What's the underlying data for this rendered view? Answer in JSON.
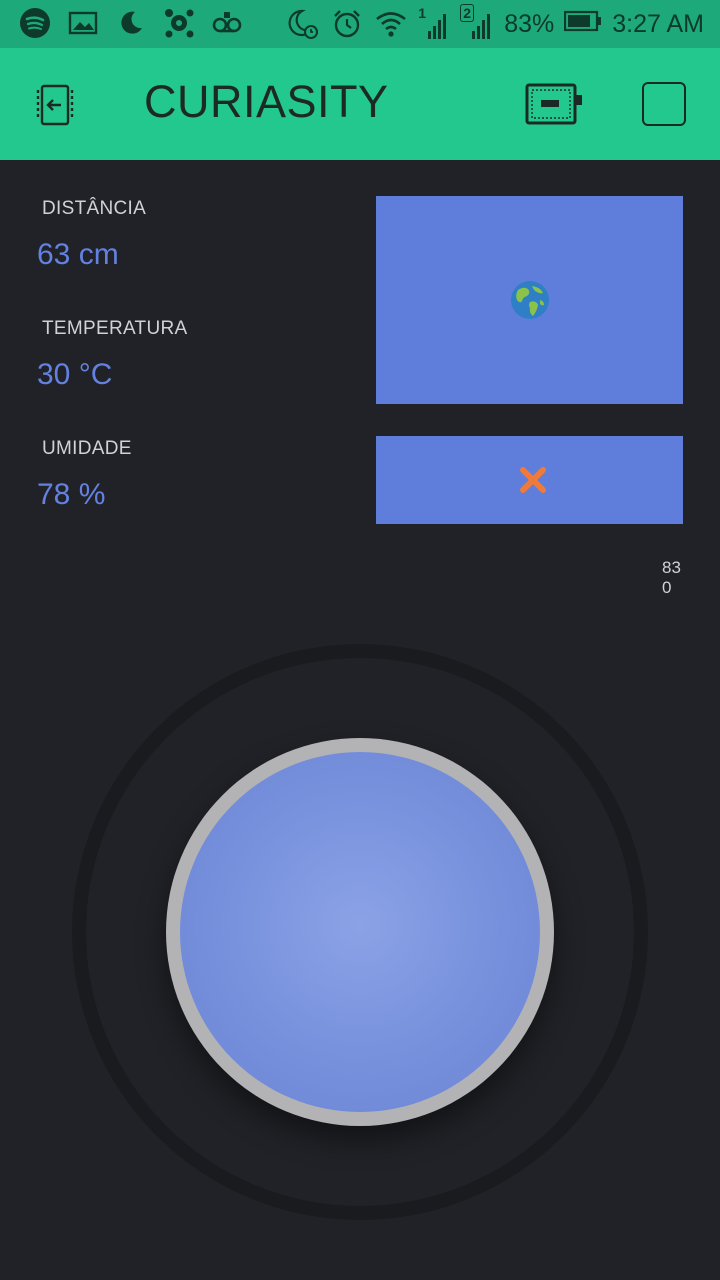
{
  "status_bar": {
    "battery_percent": "83%",
    "time": "3:27 AM",
    "sim1": "1",
    "sim2": "2",
    "icons_left": [
      "spotify-icon",
      "gallery-icon",
      "moon-icon",
      "avast-icon",
      "voicemail-icon"
    ],
    "icons_right": [
      "night-mode-icon",
      "alarm-icon",
      "wifi-icon",
      "signal-sim1-icon",
      "signal-sim2-icon",
      "battery-icon"
    ]
  },
  "header": {
    "title": "CURIASITY",
    "back_icon": "exit-icon",
    "device_icon": "device-board-icon",
    "stop_icon": "stop-icon"
  },
  "sensors": {
    "distance": {
      "label": "DISTÂNCIA",
      "value": "63 cm"
    },
    "temperature": {
      "label": "TEMPERATURA",
      "value": "30 °C"
    },
    "humidity": {
      "label": "UMIDADE",
      "value": "78 %"
    }
  },
  "widgets": {
    "map_icon": "globe-icon",
    "status_icon": "close-icon"
  },
  "joystick": {
    "x_value": "83",
    "y_value": "0"
  },
  "colors": {
    "statusbar": "#1ea97a",
    "header": "#23c88f",
    "background": "#212227",
    "accent": "#6381e0",
    "panel": "#5f7ddb",
    "x_mark": "#f07a3a"
  }
}
